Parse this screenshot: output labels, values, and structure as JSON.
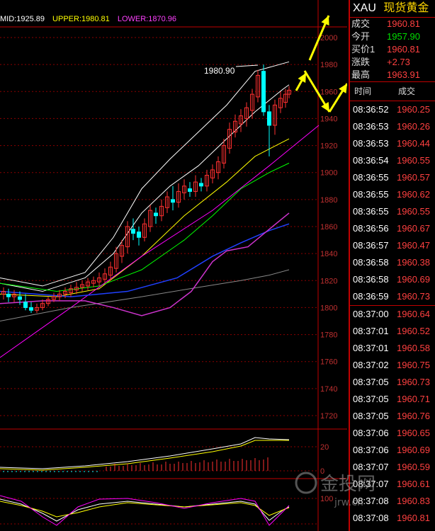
{
  "boll": {
    "mid": "MID:1925.89",
    "upper": "UPPER:1980.81",
    "lower": "LOWER:1870.96"
  },
  "colors": {
    "mid": "#ffffff",
    "upper": "#ffff00",
    "lower": "#ff00ff",
    "grid": "#8b0000",
    "up": "#ff3030",
    "down": "#00ffff",
    "arrow": "#ffff00"
  },
  "axis": {
    "main_ticks": [
      "2000",
      "1980",
      "1960",
      "1940",
      "1920",
      "1900",
      "1880",
      "1860",
      "1840",
      "1820",
      "1800",
      "1780",
      "1760",
      "1740",
      "1720"
    ],
    "macd_ticks": [
      "20",
      "0"
    ],
    "kdj_ticks": [
      "100"
    ]
  },
  "annotation": {
    "high_label": "1980.90"
  },
  "quote": {
    "code": "XAU",
    "name": "现货黄金",
    "rows": [
      {
        "label": "成交",
        "value": "1960.81",
        "color": "red"
      },
      {
        "label": "今开",
        "value": "1957.90",
        "color": "green"
      },
      {
        "label": "买价1",
        "value": "1960.81",
        "color": "red"
      },
      {
        "label": "涨跌",
        "value": "+2.73",
        "color": "red"
      },
      {
        "label": "最高",
        "value": "1963.91",
        "color": "red"
      }
    ],
    "ticks_header": {
      "time": "时间",
      "price": "成交"
    },
    "ticks": [
      [
        "08:36:52",
        "1960.25"
      ],
      [
        "08:36:53",
        "1960.26"
      ],
      [
        "08:36:53",
        "1960.44"
      ],
      [
        "08:36:54",
        "1960.55"
      ],
      [
        "08:36:55",
        "1960.57"
      ],
      [
        "08:36:55",
        "1960.62"
      ],
      [
        "08:36:55",
        "1960.55"
      ],
      [
        "08:36:56",
        "1960.67"
      ],
      [
        "08:36:57",
        "1960.47"
      ],
      [
        "08:36:58",
        "1960.38"
      ],
      [
        "08:36:58",
        "1960.69"
      ],
      [
        "08:36:59",
        "1960.73"
      ],
      [
        "08:37:00",
        "1960.64"
      ],
      [
        "08:37:01",
        "1960.52"
      ],
      [
        "08:37:01",
        "1960.58"
      ],
      [
        "08:37:02",
        "1960.75"
      ],
      [
        "08:37:05",
        "1960.73"
      ],
      [
        "08:37:05",
        "1960.71"
      ],
      [
        "08:37:05",
        "1960.76"
      ],
      [
        "08:37:06",
        "1960.65"
      ],
      [
        "08:37:06",
        "1960.69"
      ],
      [
        "08:37:07",
        "1960.59"
      ],
      [
        "08:37:07",
        "1960.61"
      ],
      [
        "08:37:08",
        "1960.83"
      ],
      [
        "08:37:08",
        "1960.81"
      ]
    ]
  },
  "watermark": {
    "text": "金投网",
    "url": "jrw.cn"
  }
}
